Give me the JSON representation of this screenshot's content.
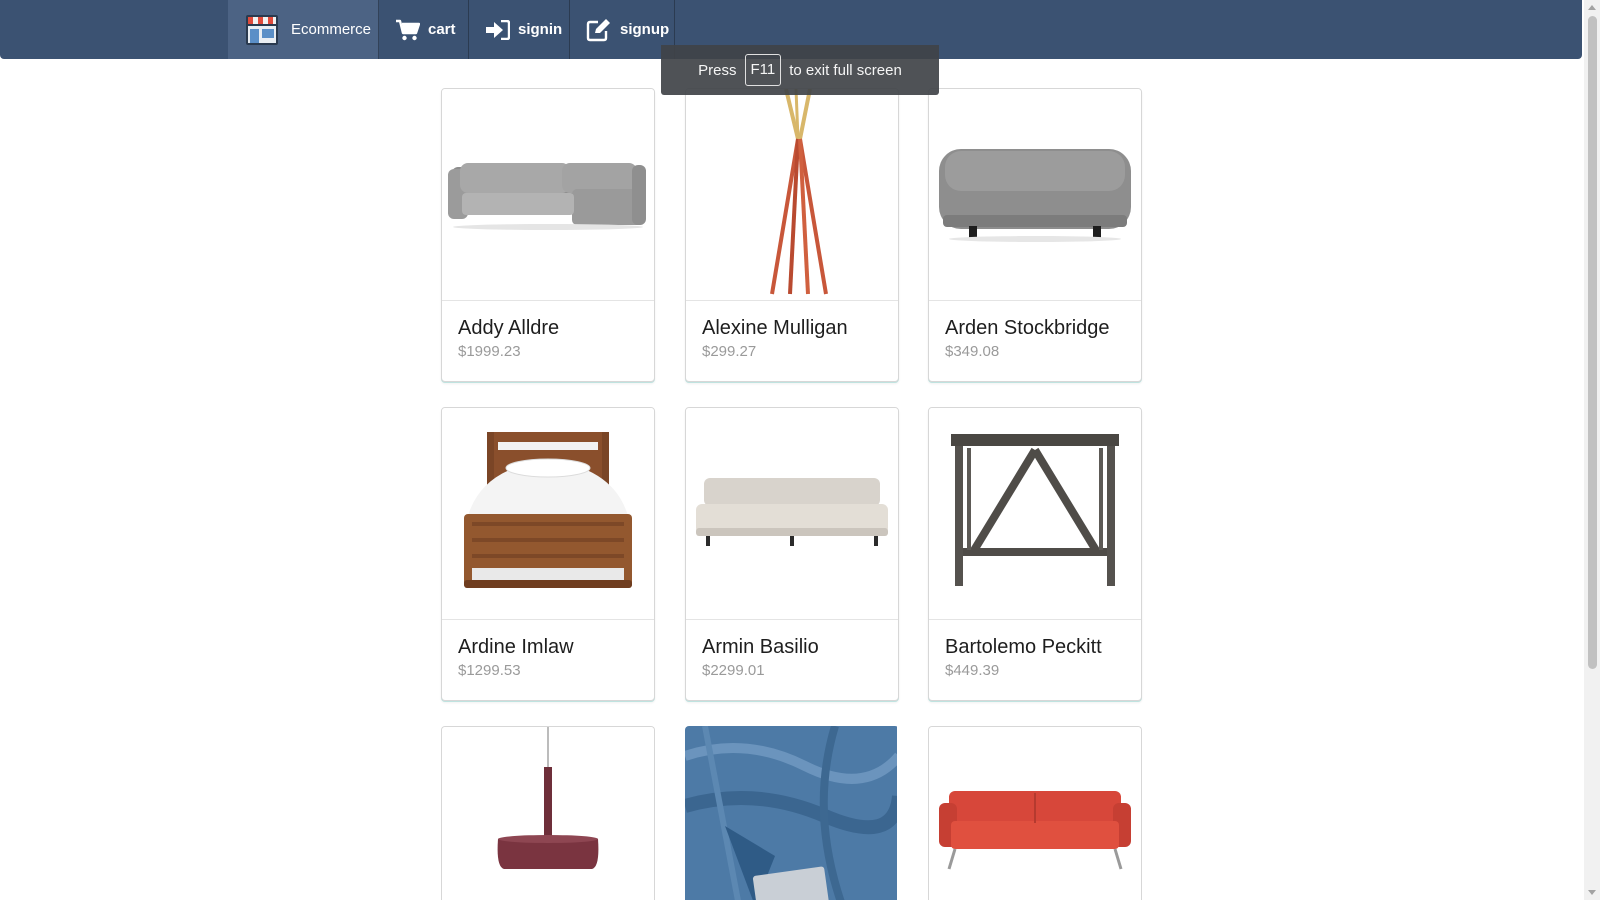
{
  "nav": {
    "brand": "Ecommerce",
    "cart": "cart",
    "signin": "signin",
    "signup": "signup"
  },
  "toast": {
    "before": "Press",
    "key": "F11",
    "after": "to exit full screen"
  },
  "products": [
    {
      "name": "Addy Alldre",
      "price": "$1999.23",
      "image": "gray-sectional-sofa"
    },
    {
      "name": "Alexine Mulligan",
      "price": "$299.27",
      "image": "coat-rack"
    },
    {
      "name": "Arden Stockbridge",
      "price": "$349.08",
      "image": "gray-ottoman"
    },
    {
      "name": "Ardine Imlaw",
      "price": "$1299.53",
      "image": "wooden-bed"
    },
    {
      "name": "Armin Basilio",
      "price": "$2299.01",
      "image": "beige-daybed-sofa"
    },
    {
      "name": "Bartolemo Peckitt",
      "price": "$449.39",
      "image": "side-table"
    },
    {
      "name": "",
      "price": "",
      "image": "pendant-lamp"
    },
    {
      "name": "",
      "price": "",
      "image": "denim-fabric"
    },
    {
      "name": "",
      "price": "",
      "image": "red-sofa"
    }
  ],
  "colors": {
    "navbar": "#3b5272",
    "navbar_active": "#4c6384",
    "price_text": "#9a9a9a"
  }
}
